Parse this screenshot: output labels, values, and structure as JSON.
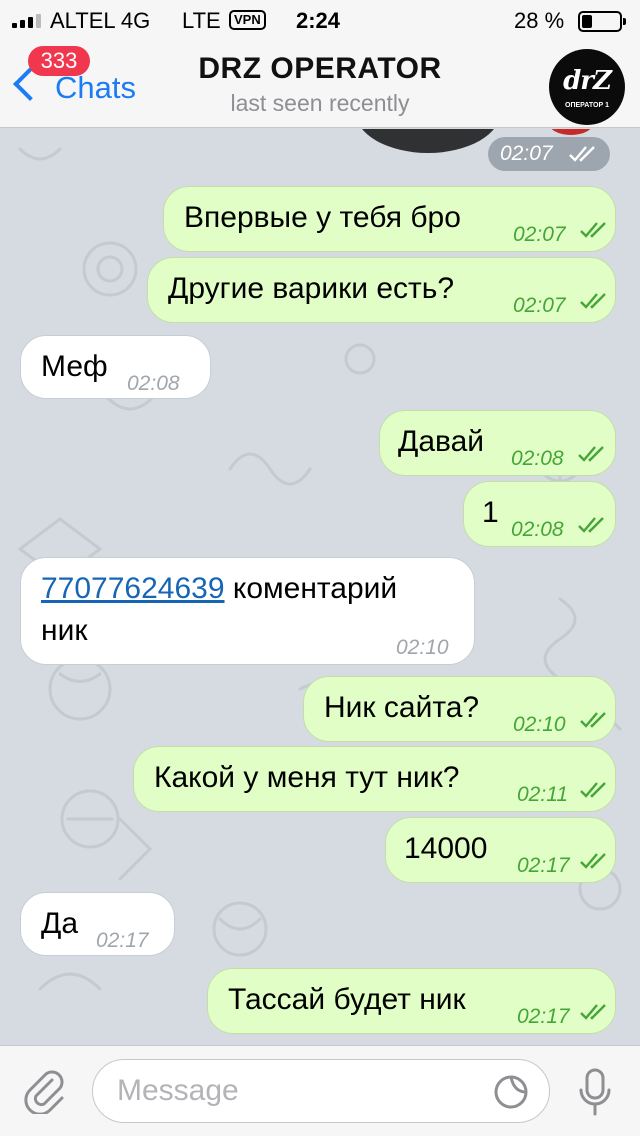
{
  "status_bar": {
    "carrier": "ALTEL 4G",
    "network": "LTE",
    "vpn": "VPN",
    "time": "2:24",
    "battery": "28 %",
    "battery_level": 0.28
  },
  "header": {
    "back_label": "Chats",
    "unread_count": "333",
    "title": "DRZ OPERATOR",
    "subtitle": "last seen recently",
    "avatar_logo": "drZ",
    "avatar_caption": "ОПЕРАТОР 1"
  },
  "chat": {
    "media_time": "02:07",
    "messages": [
      {
        "dir": "out",
        "text": "Впервые у тебя бро",
        "time": "02:07"
      },
      {
        "dir": "out",
        "text": "Другие варики есть?",
        "time": "02:07"
      },
      {
        "dir": "in",
        "text": "Меф",
        "time": "02:08"
      },
      {
        "dir": "out",
        "text": "Давай",
        "time": "02:08"
      },
      {
        "dir": "out",
        "text": "1",
        "time": "02:08"
      },
      {
        "dir": "in",
        "link": "77077624639",
        "text_after_link": " коментарий",
        "text_line2": "ник",
        "time": "02:10"
      },
      {
        "dir": "out",
        "text": "Ник сайта?",
        "time": "02:10"
      },
      {
        "dir": "out",
        "text": "Какой у меня тут ник?",
        "time": "02:11"
      },
      {
        "dir": "out",
        "text": "14000",
        "time": "02:17"
      },
      {
        "dir": "in",
        "text": "Да",
        "time": "02:17"
      },
      {
        "dir": "out",
        "text": "Тассай будет ник",
        "time": "02:17"
      }
    ]
  },
  "input": {
    "placeholder": "Message",
    "value": ""
  },
  "icons": {
    "attach": "paperclip-icon",
    "sticker": "sticker-icon",
    "mic": "microphone-icon",
    "back": "chevron-left-icon",
    "read": "double-check-icon"
  },
  "colors": {
    "accent": "#1b7cf3",
    "badge": "#f0374d",
    "outgoing_bubble": "#e1fec6",
    "incoming_bubble": "#ffffff",
    "outgoing_time": "#45a637",
    "link": "#1766b5"
  }
}
